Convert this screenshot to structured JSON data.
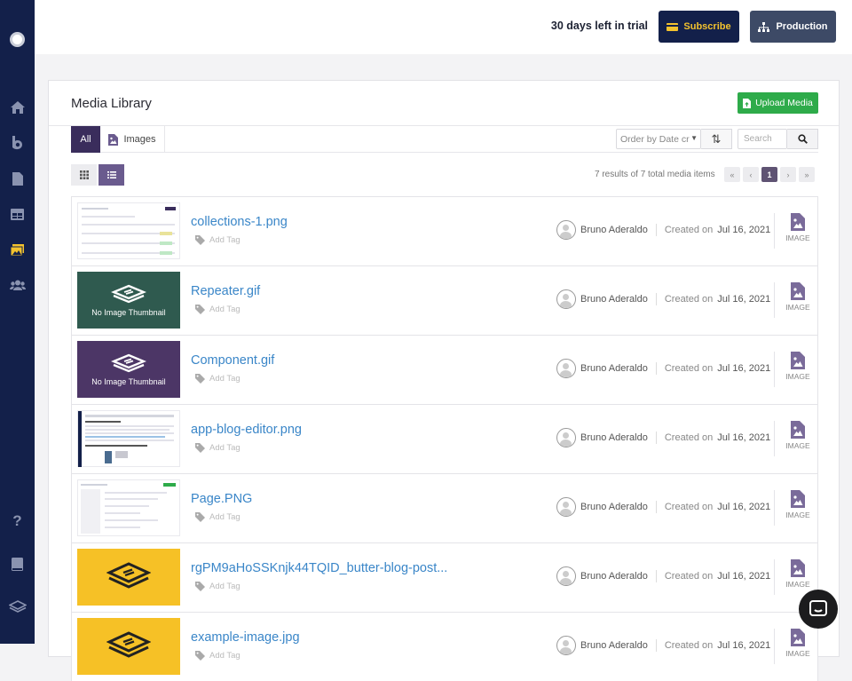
{
  "topbar": {
    "trial_text": "30 days left in trial",
    "subscribe_label": "Subscribe",
    "production_label": "Production"
  },
  "sidebar": {
    "icons": [
      "home-icon",
      "blog-icon",
      "pages-icon",
      "collections-icon",
      "media-icon",
      "users-icon",
      "help-icon",
      "docs-icon",
      "layers-icon"
    ],
    "active": "media-icon"
  },
  "library": {
    "title": "Media Library",
    "upload_label": "Upload Media",
    "tabs": {
      "all": "All",
      "images": "Images"
    },
    "order_placeholder": "Order by Date cr",
    "search_placeholder": "Search",
    "results_text": "7 results of 7 total media items",
    "pager": {
      "first": "«",
      "prev": "‹",
      "current": "1",
      "next": "›",
      "last": "»"
    }
  },
  "items": [
    {
      "name": "collections-1.png",
      "tag": "Add Tag",
      "author": "Bruno Aderaldo",
      "created_label": "Created on",
      "date": "Jul 16, 2021",
      "type": "IMAGE",
      "thumb": "screenshot"
    },
    {
      "name": "Repeater.gif",
      "tag": "Add Tag",
      "author": "Bruno Aderaldo",
      "created_label": "Created on",
      "date": "Jul 16, 2021",
      "type": "IMAGE",
      "thumb": "no-thumb-green",
      "thumb_text": "No Image Thumbnail"
    },
    {
      "name": "Component.gif",
      "tag": "Add Tag",
      "author": "Bruno Aderaldo",
      "created_label": "Created on",
      "date": "Jul 16, 2021",
      "type": "IMAGE",
      "thumb": "no-thumb-purple",
      "thumb_text": "No Image Thumbnail"
    },
    {
      "name": "app-blog-editor.png",
      "tag": "Add Tag",
      "author": "Bruno Aderaldo",
      "created_label": "Created on",
      "date": "Jul 16, 2021",
      "type": "IMAGE",
      "thumb": "screenshot"
    },
    {
      "name": "Page.PNG",
      "tag": "Add Tag",
      "author": "Bruno Aderaldo",
      "created_label": "Created on",
      "date": "Jul 16, 2021",
      "type": "IMAGE",
      "thumb": "screenshot"
    },
    {
      "name": "rgPM9aHoSSKnjk44TQID_butter-blog-post...",
      "tag": "Add Tag",
      "author": "Bruno Aderaldo",
      "created_label": "Created on",
      "date": "Jul 16, 2021",
      "type": "IMAGE",
      "thumb": "yellow"
    },
    {
      "name": "example-image.jpg",
      "tag": "Add Tag",
      "author": "Bruno Aderaldo",
      "created_label": "Created on",
      "date": "Jul 16, 2021",
      "type": "IMAGE",
      "thumb": "yellow"
    }
  ],
  "colors": {
    "sidebar": "#13204a",
    "subscribe_text": "#f3c22e",
    "upload_button": "#2eab4a",
    "active_tab": "#3a2d5c",
    "link": "#3a86c8"
  }
}
